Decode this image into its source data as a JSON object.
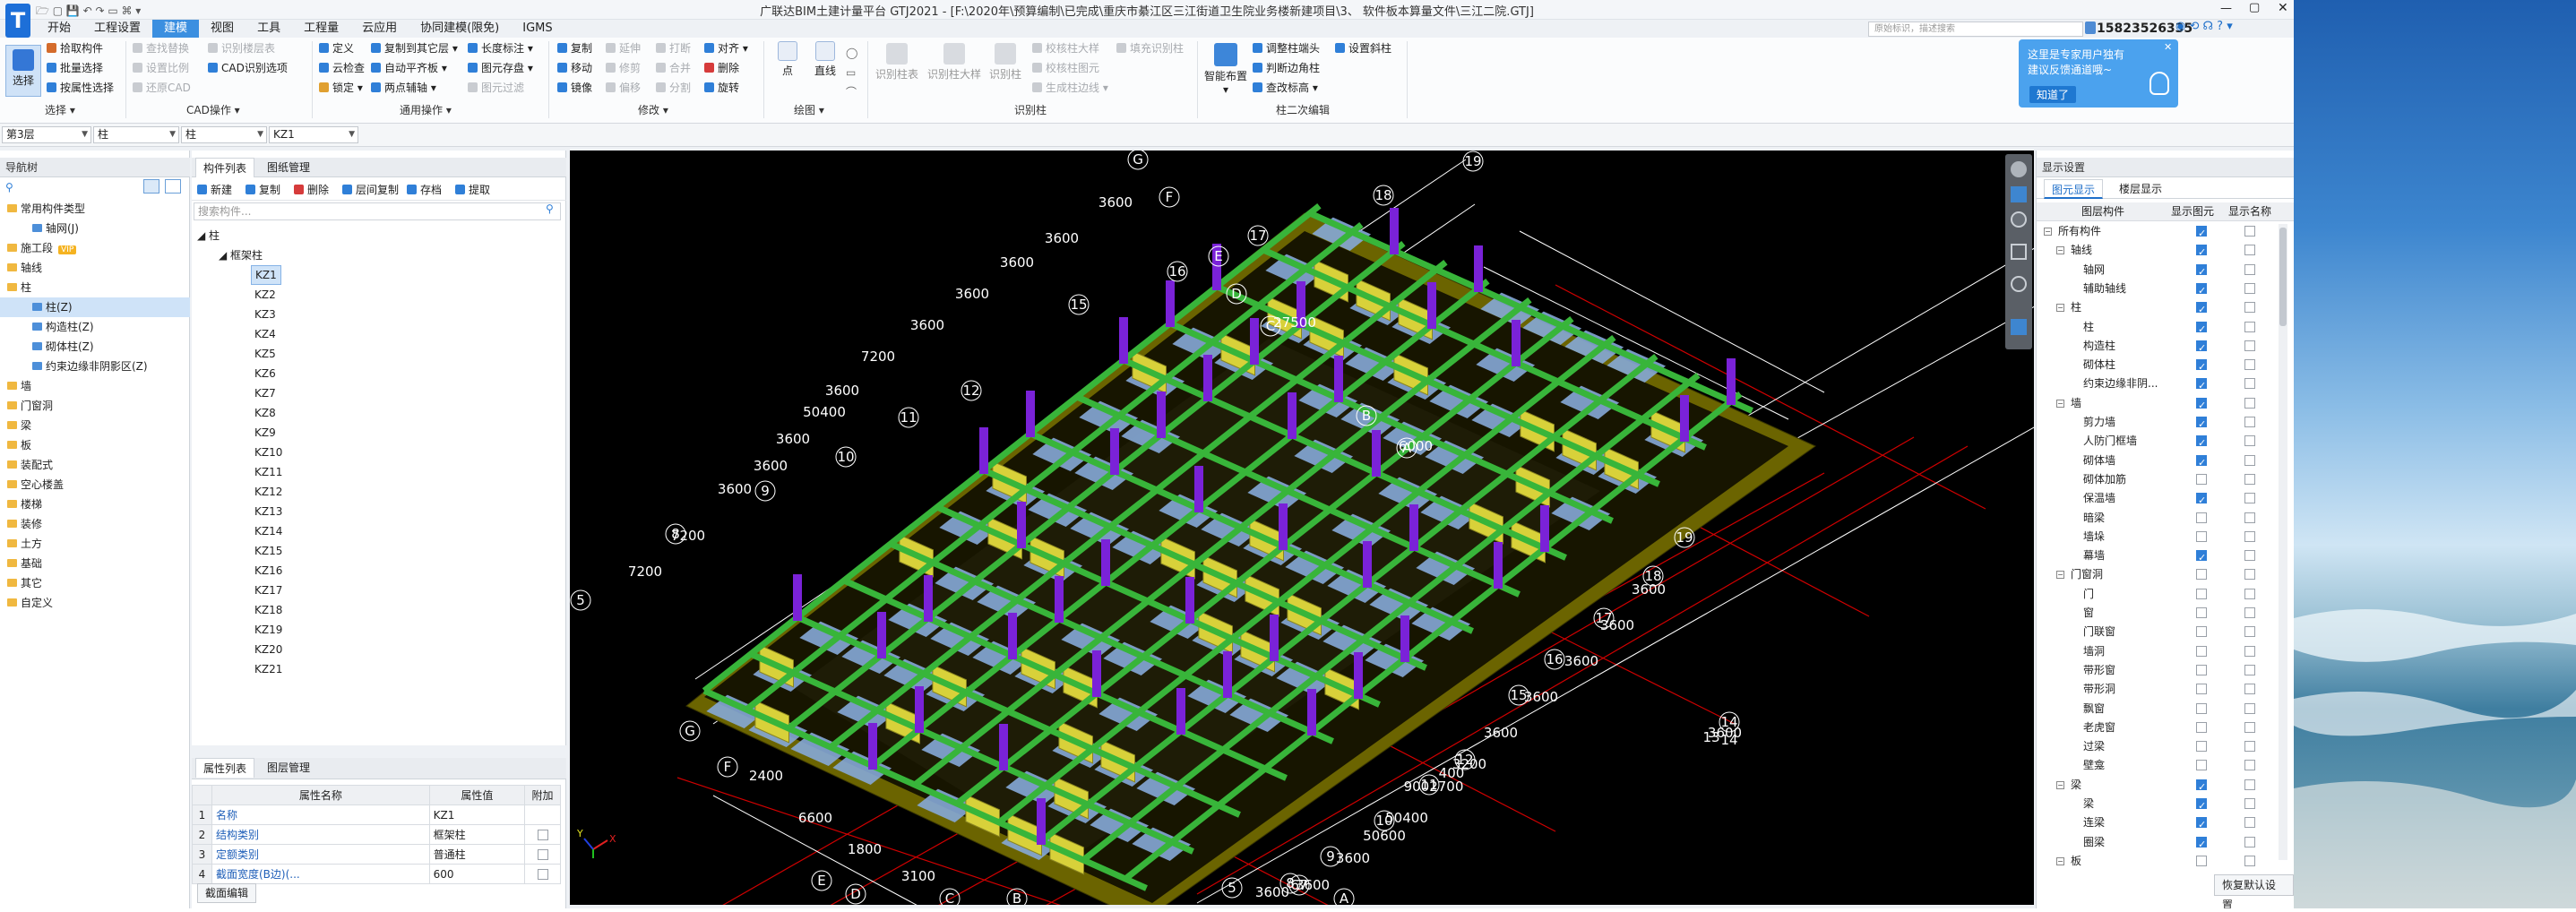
{
  "window": {
    "title": "广联达BIM土建计量平台 GTJ2021 - [F:\\2020年\\预算编制\\已完成\\重庆市綦江区三江街道卫生院业务楼新建项目\\3、 软件板本算量文件\\三江二院.GTJ]",
    "logo": "T",
    "phone": "15823526335",
    "search_placeholder": "原始标识，描述搜索"
  },
  "menu": [
    "开始",
    "工程设置",
    "建模",
    "视图",
    "工具",
    "工程量",
    "云应用",
    "协同建模(限免)",
    "IGMS"
  ],
  "menu_active": "建模",
  "ribbon": {
    "select_btn": "选择",
    "group_select": "选择",
    "pick": [
      "拾取构件",
      "批量选择",
      "按属性选择"
    ],
    "cad": [
      "查找替换",
      "设置比例",
      "还原CAD",
      "识别楼层表",
      "CAD识别选项"
    ],
    "group_cad": "CAD操作",
    "general": [
      "定义",
      "云检查",
      "锁定",
      "复制到其它层",
      "自动平齐板",
      "两点辅轴",
      "长度标注",
      "图元存盘",
      "图元过滤"
    ],
    "group_general": "通用操作",
    "modify": [
      "复制",
      "移动",
      "镜像",
      "延伸",
      "修剪",
      "偏移",
      "打断",
      "合并",
      "分割",
      "对齐",
      "删除",
      "旋转"
    ],
    "group_modify": "修改",
    "draw": [
      "点",
      "直线"
    ],
    "group_draw": "绘图",
    "recog": [
      "识别柱表",
      "识别柱大样",
      "识别柱",
      "校核柱大样",
      "校核柱图元",
      "生成柱边线",
      "填充识别柱"
    ],
    "group_recog": "识别柱",
    "smart": "智能布置",
    "secondary": [
      "调整柱端头",
      "判断边角柱",
      "查改标高",
      "设置斜柱"
    ],
    "group_secondary": "柱二次编辑"
  },
  "tip": {
    "line1": "这里是专家用户独有",
    "line2": "建议反馈通道哦~",
    "button": "知道了"
  },
  "selector": {
    "floor": "第3层",
    "type1": "柱",
    "type2": "柱",
    "component": "KZ1"
  },
  "nav": {
    "header": "导航树",
    "items": [
      "常用构件类型",
      "轴网(J)",
      "施工段",
      "轴线",
      "柱",
      "柱(Z)",
      "构造柱(Z)",
      "砌体柱(Z)",
      "约束边缘非阴影区(Z)",
      "墙",
      "门窗洞",
      "梁",
      "板",
      "装配式",
      "空心楼盖",
      "楼梯",
      "装修",
      "土方",
      "基础",
      "其它",
      "自定义"
    ],
    "vip": "VIP"
  },
  "components": {
    "tab1": "构件列表",
    "tab2": "图纸管理",
    "toolbar": [
      "新建",
      "复制",
      "删除",
      "层间复制",
      "存档",
      "提取"
    ],
    "search": "搜索构件...",
    "root": "柱",
    "sub": "框架柱",
    "items": [
      "KZ1",
      "KZ2",
      "KZ3",
      "KZ4",
      "KZ5",
      "KZ6",
      "KZ7",
      "KZ8",
      "KZ9",
      "KZ10",
      "KZ11",
      "KZ12",
      "KZ13",
      "KZ14",
      "KZ15",
      "KZ16",
      "KZ17",
      "KZ18",
      "KZ19",
      "KZ20",
      "KZ21"
    ]
  },
  "properties": {
    "tab1": "属性列表",
    "tab2": "图层管理",
    "headers": [
      "属性名称",
      "属性值",
      "附加"
    ],
    "rows": [
      {
        "n": "1",
        "name": "名称",
        "value": "KZ1"
      },
      {
        "n": "2",
        "name": "结构类别",
        "value": "框架柱"
      },
      {
        "n": "3",
        "name": "定额类别",
        "value": "普通柱"
      },
      {
        "n": "4",
        "name": "截面宽度(B边)(...",
        "value": "600"
      }
    ],
    "button": "截面编辑"
  },
  "viewport": {
    "axes_top": [
      "19",
      "18",
      "17",
      "16",
      "15",
      "12",
      "11",
      "10",
      "9",
      "8",
      "5",
      "1"
    ],
    "axes_letters": [
      "G",
      "F",
      "E",
      "D",
      "C",
      "B",
      "A"
    ],
    "dims_top": [
      "3600",
      "3600",
      "3600",
      "3600",
      "3600",
      "7200",
      "3600",
      "50400",
      "3600",
      "3600",
      "3600",
      "7200",
      "7200"
    ],
    "dims_right": [
      "27500",
      "6000"
    ],
    "axes_bottom": [
      "19",
      "18",
      "17",
      "16",
      "15",
      "14",
      "12",
      "11",
      "10",
      "9",
      "8",
      "67",
      "5"
    ],
    "dims_bottom": [
      "3600",
      "3600",
      "3600",
      "3600",
      "3600",
      "3200",
      "400",
      "9002700",
      "50400",
      "50600",
      "3600",
      "3600",
      "3600"
    ],
    "dims_left": [
      "2400",
      "6600",
      "1800",
      "3100"
    ],
    "letters_bottom": [
      "G",
      "F",
      "E",
      "D",
      "C",
      "A",
      "B"
    ],
    "extra_labels": [
      "13",
      "3600",
      "14"
    ]
  },
  "display": {
    "header": "显示设置",
    "tab1": "图元显示",
    "tab2": "楼层显示",
    "headers": [
      "图层构件",
      "显示图元",
      "显示名称"
    ],
    "rows": [
      {
        "label": "所有构件",
        "level": 0,
        "a": true,
        "b": false
      },
      {
        "label": "轴线",
        "level": 1,
        "a": true,
        "b": false
      },
      {
        "label": "轴网",
        "level": 2,
        "a": true,
        "b": false
      },
      {
        "label": "辅助轴线",
        "level": 2,
        "a": true,
        "b": false
      },
      {
        "label": "柱",
        "level": 1,
        "a": true,
        "b": false
      },
      {
        "label": "柱",
        "level": 2,
        "a": true,
        "b": false
      },
      {
        "label": "构造柱",
        "level": 2,
        "a": true,
        "b": false
      },
      {
        "label": "砌体柱",
        "level": 2,
        "a": true,
        "b": false
      },
      {
        "label": "约束边缘非阴...",
        "level": 2,
        "a": true,
        "b": false
      },
      {
        "label": "墙",
        "level": 1,
        "a": true,
        "b": false
      },
      {
        "label": "剪力墙",
        "level": 2,
        "a": true,
        "b": false
      },
      {
        "label": "人防门框墙",
        "level": 2,
        "a": true,
        "b": false
      },
      {
        "label": "砌体墙",
        "level": 2,
        "a": true,
        "b": false
      },
      {
        "label": "砌体加筋",
        "level": 2,
        "a": false,
        "b": false
      },
      {
        "label": "保温墙",
        "level": 2,
        "a": true,
        "b": false
      },
      {
        "label": "暗梁",
        "level": 2,
        "a": false,
        "b": false
      },
      {
        "label": "墙垛",
        "level": 2,
        "a": false,
        "b": false
      },
      {
        "label": "幕墙",
        "level": 2,
        "a": true,
        "b": false
      },
      {
        "label": "门窗洞",
        "level": 1,
        "a": false,
        "b": false
      },
      {
        "label": "门",
        "level": 2,
        "a": false,
        "b": false
      },
      {
        "label": "窗",
        "level": 2,
        "a": false,
        "b": false
      },
      {
        "label": "门联窗",
        "level": 2,
        "a": false,
        "b": false
      },
      {
        "label": "墙洞",
        "level": 2,
        "a": false,
        "b": false
      },
      {
        "label": "带形窗",
        "level": 2,
        "a": false,
        "b": false
      },
      {
        "label": "带形洞",
        "level": 2,
        "a": false,
        "b": false
      },
      {
        "label": "飘窗",
        "level": 2,
        "a": false,
        "b": false
      },
      {
        "label": "老虎窗",
        "level": 2,
        "a": false,
        "b": false
      },
      {
        "label": "过梁",
        "level": 2,
        "a": false,
        "b": false
      },
      {
        "label": "壁龛",
        "level": 2,
        "a": false,
        "b": false
      },
      {
        "label": "梁",
        "level": 1,
        "a": true,
        "b": false
      },
      {
        "label": "梁",
        "level": 2,
        "a": true,
        "b": false
      },
      {
        "label": "连梁",
        "level": 2,
        "a": true,
        "b": false
      },
      {
        "label": "圈梁",
        "level": 2,
        "a": true,
        "b": false
      },
      {
        "label": "板",
        "level": 1,
        "a": false,
        "b": false
      }
    ],
    "reset": "恢复默认设置"
  }
}
